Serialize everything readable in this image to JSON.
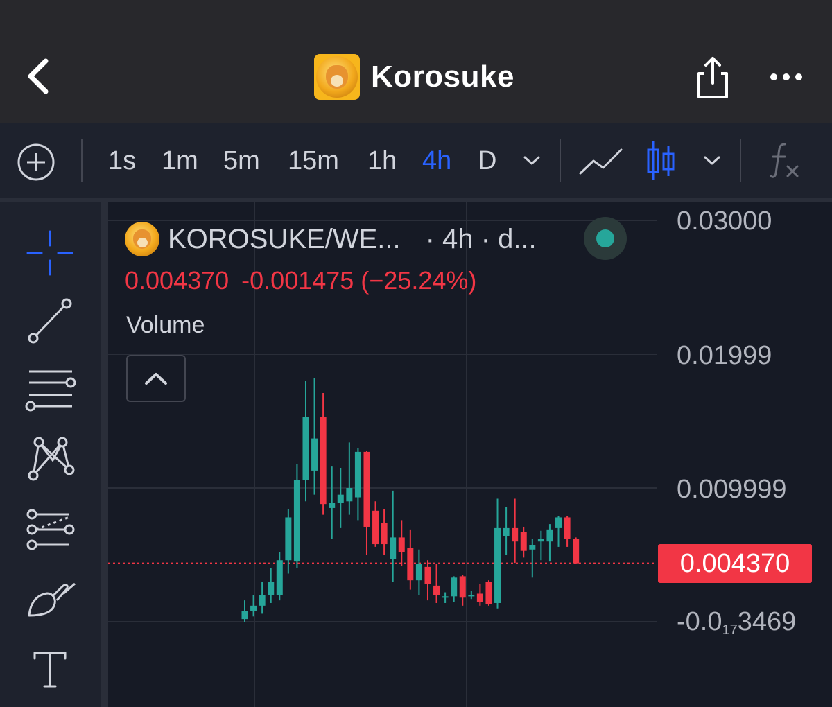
{
  "header": {
    "title": "Korosuke",
    "icons": {
      "back": "chevron-left-icon",
      "share": "share-icon",
      "more": "more-horizontal-icon",
      "avatar": "korosuke-coin-avatar"
    }
  },
  "toolbar": {
    "timeframes": [
      "1s",
      "1m",
      "5m",
      "15m",
      "1h",
      "4h",
      "D"
    ],
    "active_timeframe": "4h",
    "icons": [
      "add-circle-icon",
      "chevron-down-icon",
      "line-chart-icon",
      "candlestick-icon",
      "chevron-down-icon",
      "indicators-fx-icon"
    ]
  },
  "tools": [
    "crosshair-icon",
    "trend-line-icon",
    "fib-retracement-icon",
    "pattern-icon",
    "prediction-icon",
    "brush-icon",
    "text-icon"
  ],
  "legend": {
    "symbol": "KOROSUKE/WE...",
    "interval": "· 4h · d...",
    "last_price": "0.004370",
    "change": "-0.001475 (−25.24%)",
    "volume_label": "Volume",
    "status": "live"
  },
  "price_axis": {
    "labels": [
      "0.03000",
      "0.01999",
      "0.009999"
    ],
    "min_label_prefix": "-0.0",
    "min_label_sub": "17",
    "min_label_suffix": "3469",
    "last_price_tag": "0.004370"
  },
  "colors": {
    "up": "#26a69a",
    "down": "#f23645",
    "accent": "#2962ff",
    "background": "#161a25",
    "header_background": "#28282c"
  },
  "chart_data": {
    "type": "candlestick",
    "interval": "4h",
    "ylim": [
      0,
      0.03
    ],
    "gridlines": [
      0.03,
      0.02,
      0.01,
      0
    ],
    "last_price": 0.00437,
    "candles": [
      {
        "o": 0.0002,
        "h": 0.0016,
        "l": 0.0,
        "c": 0.0008
      },
      {
        "o": 0.0008,
        "h": 0.002,
        "l": 0.0004,
        "c": 0.0012
      },
      {
        "o": 0.0012,
        "h": 0.003,
        "l": 0.0006,
        "c": 0.002
      },
      {
        "o": 0.002,
        "h": 0.004,
        "l": 0.0014,
        "c": 0.003
      },
      {
        "o": 0.002,
        "h": 0.0052,
        "l": 0.0016,
        "c": 0.0046
      },
      {
        "o": 0.0046,
        "h": 0.0084,
        "l": 0.0036,
        "c": 0.0078
      },
      {
        "o": 0.0045,
        "h": 0.0118,
        "l": 0.004,
        "c": 0.0106
      },
      {
        "o": 0.0106,
        "h": 0.018,
        "l": 0.009,
        "c": 0.0153
      },
      {
        "o": 0.0113,
        "h": 0.0182,
        "l": 0.0095,
        "c": 0.0137
      },
      {
        "o": 0.0153,
        "h": 0.0171,
        "l": 0.008,
        "c": 0.0088
      },
      {
        "o": 0.0085,
        "h": 0.0116,
        "l": 0.0062,
        "c": 0.0089
      },
      {
        "o": 0.0089,
        "h": 0.0115,
        "l": 0.007,
        "c": 0.0095
      },
      {
        "o": 0.009,
        "h": 0.0134,
        "l": 0.008,
        "c": 0.01
      },
      {
        "o": 0.0093,
        "h": 0.013,
        "l": 0.0076,
        "c": 0.0127
      },
      {
        "o": 0.0127,
        "h": 0.0128,
        "l": 0.005,
        "c": 0.0071
      },
      {
        "o": 0.0083,
        "h": 0.009,
        "l": 0.0056,
        "c": 0.0058
      },
      {
        "o": 0.0074,
        "h": 0.0084,
        "l": 0.005,
        "c": 0.0058
      },
      {
        "o": 0.0047,
        "h": 0.0098,
        "l": 0.003,
        "c": 0.0063
      },
      {
        "o": 0.0063,
        "h": 0.0076,
        "l": 0.0042,
        "c": 0.0052
      },
      {
        "o": 0.0055,
        "h": 0.0069,
        "l": 0.0024,
        "c": 0.0031
      },
      {
        "o": 0.0031,
        "h": 0.0054,
        "l": 0.002,
        "c": 0.0043
      },
      {
        "o": 0.0041,
        "h": 0.0046,
        "l": 0.0016,
        "c": 0.0028
      },
      {
        "o": 0.0027,
        "h": 0.0043,
        "l": 0.0014,
        "c": 0.002
      },
      {
        "o": 0.0019,
        "h": 0.0022,
        "l": 0.0014,
        "c": 0.0019
      },
      {
        "o": 0.0019,
        "h": 0.0034,
        "l": 0.0015,
        "c": 0.0033
      },
      {
        "o": 0.0034,
        "h": 0.0035,
        "l": 0.0012,
        "c": 0.0018
      },
      {
        "o": 0.0019,
        "h": 0.0023,
        "l": 0.0017,
        "c": 0.002
      },
      {
        "o": 0.0021,
        "h": 0.0028,
        "l": 0.0012,
        "c": 0.0015
      },
      {
        "o": 0.003,
        "h": 0.0031,
        "l": 0.0012,
        "c": 0.0013
      },
      {
        "o": 0.0014,
        "h": 0.0092,
        "l": 0.001,
        "c": 0.007
      },
      {
        "o": 0.0064,
        "h": 0.0086,
        "l": 0.005,
        "c": 0.007
      },
      {
        "o": 0.007,
        "h": 0.0092,
        "l": 0.0044,
        "c": 0.006
      },
      {
        "o": 0.0067,
        "h": 0.0071,
        "l": 0.0048,
        "c": 0.0053
      },
      {
        "o": 0.0054,
        "h": 0.0062,
        "l": 0.0033,
        "c": 0.0057
      },
      {
        "o": 0.006,
        "h": 0.0068,
        "l": 0.0046,
        "c": 0.0062
      },
      {
        "o": 0.006,
        "h": 0.0073,
        "l": 0.0045,
        "c": 0.0069
      },
      {
        "o": 0.007,
        "h": 0.0079,
        "l": 0.0056,
        "c": 0.0078
      },
      {
        "o": 0.0078,
        "h": 0.0079,
        "l": 0.0056,
        "c": 0.0062
      },
      {
        "o": 0.0062,
        "h": 0.0063,
        "l": 0.0043,
        "c": 0.00437
      }
    ]
  }
}
